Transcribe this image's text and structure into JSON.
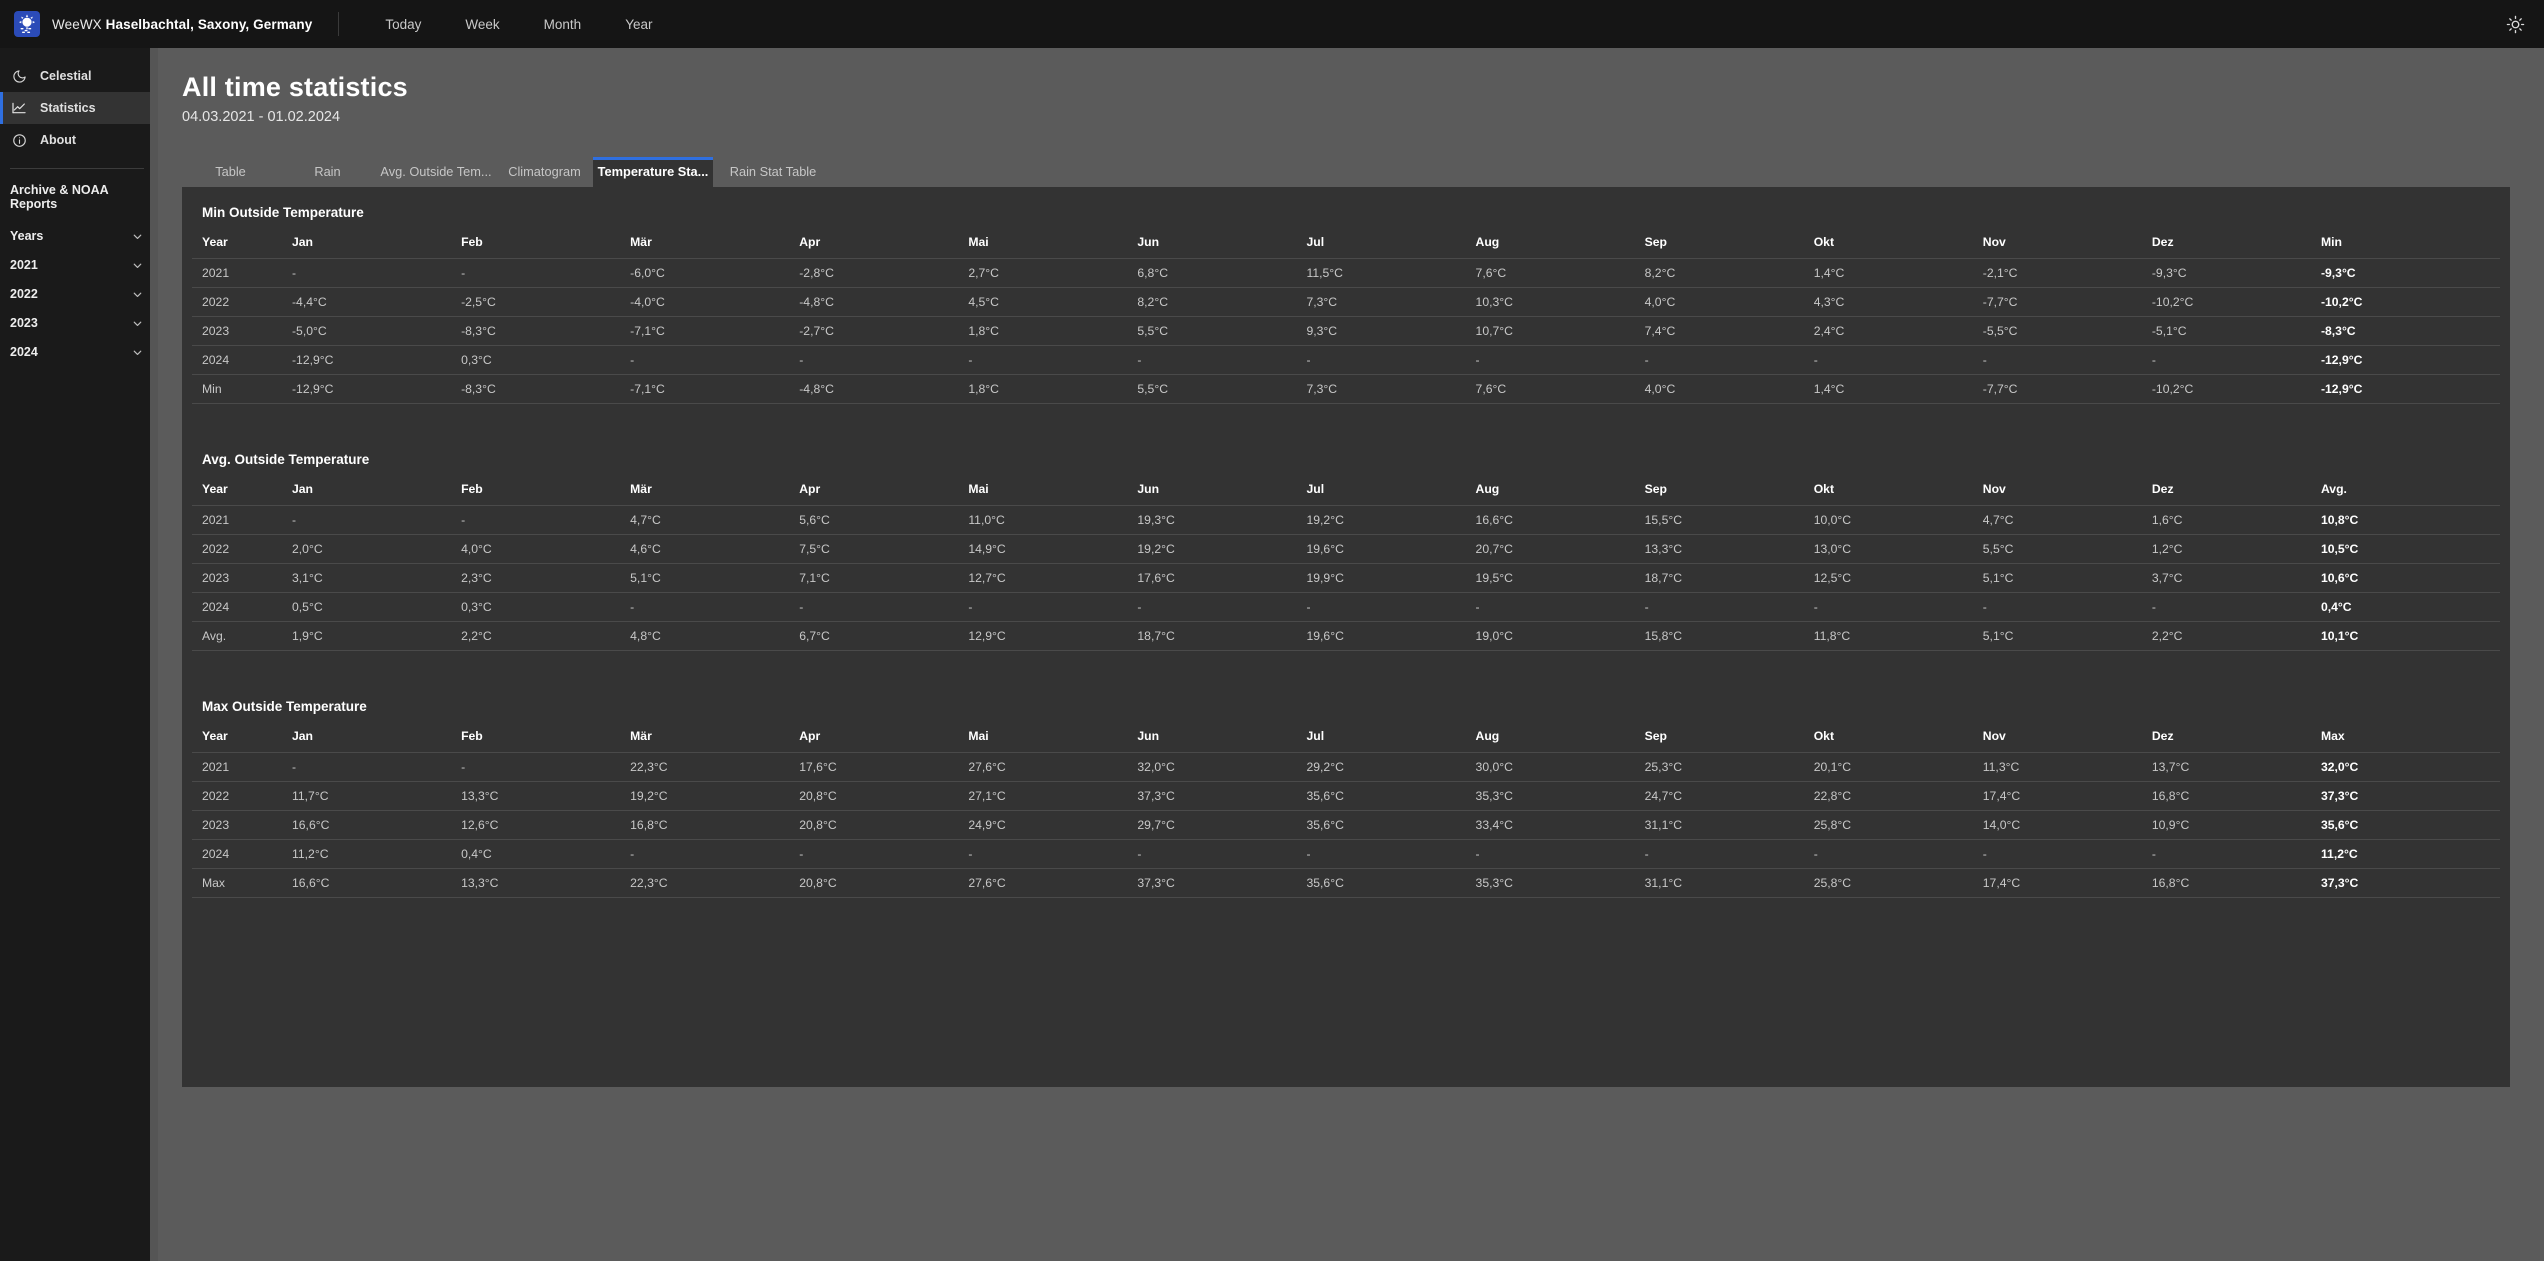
{
  "topbar": {
    "logo_icon": "weewx-sun-logo",
    "app_name": "WeeWX",
    "location": "Haselbachtal, Saxony, Germany",
    "nav": [
      {
        "label": "Today"
      },
      {
        "label": "Week"
      },
      {
        "label": "Month"
      },
      {
        "label": "Year"
      }
    ],
    "theme_toggle_icon": "sun-icon"
  },
  "sidebar": {
    "items": [
      {
        "label": "Celestial",
        "icon": "moon-icon",
        "active": false
      },
      {
        "label": "Statistics",
        "icon": "chart-line-icon",
        "active": true
      },
      {
        "label": "About",
        "icon": "info-circle-icon",
        "active": false
      }
    ],
    "heading": "Archive & NOAA Reports",
    "accordions": [
      {
        "label": "Years",
        "icon": "chevron-down-icon"
      },
      {
        "label": "2021",
        "icon": "chevron-down-icon"
      },
      {
        "label": "2022",
        "icon": "chevron-down-icon"
      },
      {
        "label": "2023",
        "icon": "chevron-down-icon"
      },
      {
        "label": "2024",
        "icon": "chevron-down-icon"
      }
    ]
  },
  "page": {
    "title": "All time statistics",
    "subtitle": "04.03.2021 - 01.02.2024"
  },
  "tabs": [
    {
      "label": "Table",
      "active": false
    },
    {
      "label": "Rain",
      "active": false
    },
    {
      "label": "Avg. Outside Tem...",
      "active": false
    },
    {
      "label": "Climatogram",
      "active": false
    },
    {
      "label": "Temperature Sta...",
      "active": true
    },
    {
      "label": "Rain Stat Table",
      "active": false
    }
  ],
  "tables": [
    {
      "title": "Min Outside Temperature",
      "columns": [
        "Year",
        "Jan",
        "Feb",
        "Mär",
        "Apr",
        "Mai",
        "Jun",
        "Jul",
        "Aug",
        "Sep",
        "Okt",
        "Nov",
        "Dez",
        "Min"
      ],
      "rows": [
        {
          "year": "2021",
          "values": [
            "-",
            "-",
            "-6,0°C",
            "-2,8°C",
            "2,7°C",
            "6,8°C",
            "11,5°C",
            "7,6°C",
            "8,2°C",
            "1,4°C",
            "-2,1°C",
            "-9,3°C"
          ],
          "total": "-9,3°C"
        },
        {
          "year": "2022",
          "values": [
            "-4,4°C",
            "-2,5°C",
            "-4,0°C",
            "-4,8°C",
            "4,5°C",
            "8,2°C",
            "7,3°C",
            "10,3°C",
            "4,0°C",
            "4,3°C",
            "-7,7°C",
            "-10,2°C"
          ],
          "total": "-10,2°C"
        },
        {
          "year": "2023",
          "values": [
            "-5,0°C",
            "-8,3°C",
            "-7,1°C",
            "-2,7°C",
            "1,8°C",
            "5,5°C",
            "9,3°C",
            "10,7°C",
            "7,4°C",
            "2,4°C",
            "-5,5°C",
            "-5,1°C"
          ],
          "total": "-8,3°C"
        },
        {
          "year": "2024",
          "values": [
            "-12,9°C",
            "0,3°C",
            "-",
            "-",
            "-",
            "-",
            "-",
            "-",
            "-",
            "-",
            "-",
            "-"
          ],
          "total": "-12,9°C"
        },
        {
          "year": "Min",
          "values": [
            "-12,9°C",
            "-8,3°C",
            "-7,1°C",
            "-4,8°C",
            "1,8°C",
            "5,5°C",
            "7,3°C",
            "7,6°C",
            "4,0°C",
            "1,4°C",
            "-7,7°C",
            "-10,2°C"
          ],
          "total": "-12,9°C",
          "summary": true
        }
      ]
    },
    {
      "title": "Avg. Outside Temperature",
      "columns": [
        "Year",
        "Jan",
        "Feb",
        "Mär",
        "Apr",
        "Mai",
        "Jun",
        "Jul",
        "Aug",
        "Sep",
        "Okt",
        "Nov",
        "Dez",
        "Avg."
      ],
      "rows": [
        {
          "year": "2021",
          "values": [
            "-",
            "-",
            "4,7°C",
            "5,6°C",
            "11,0°C",
            "19,3°C",
            "19,2°C",
            "16,6°C",
            "15,5°C",
            "10,0°C",
            "4,7°C",
            "1,6°C"
          ],
          "total": "10,8°C"
        },
        {
          "year": "2022",
          "values": [
            "2,0°C",
            "4,0°C",
            "4,6°C",
            "7,5°C",
            "14,9°C",
            "19,2°C",
            "19,6°C",
            "20,7°C",
            "13,3°C",
            "13,0°C",
            "5,5°C",
            "1,2°C"
          ],
          "total": "10,5°C"
        },
        {
          "year": "2023",
          "values": [
            "3,1°C",
            "2,3°C",
            "5,1°C",
            "7,1°C",
            "12,7°C",
            "17,6°C",
            "19,9°C",
            "19,5°C",
            "18,7°C",
            "12,5°C",
            "5,1°C",
            "3,7°C"
          ],
          "total": "10,6°C"
        },
        {
          "year": "2024",
          "values": [
            "0,5°C",
            "0,3°C",
            "-",
            "-",
            "-",
            "-",
            "-",
            "-",
            "-",
            "-",
            "-",
            "-"
          ],
          "total": "0,4°C"
        },
        {
          "year": "Avg.",
          "values": [
            "1,9°C",
            "2,2°C",
            "4,8°C",
            "6,7°C",
            "12,9°C",
            "18,7°C",
            "19,6°C",
            "19,0°C",
            "15,8°C",
            "11,8°C",
            "5,1°C",
            "2,2°C"
          ],
          "total": "10,1°C",
          "summary": true
        }
      ]
    },
    {
      "title": "Max Outside Temperature",
      "columns": [
        "Year",
        "Jan",
        "Feb",
        "Mär",
        "Apr",
        "Mai",
        "Jun",
        "Jul",
        "Aug",
        "Sep",
        "Okt",
        "Nov",
        "Dez",
        "Max"
      ],
      "rows": [
        {
          "year": "2021",
          "values": [
            "-",
            "-",
            "22,3°C",
            "17,6°C",
            "27,6°C",
            "32,0°C",
            "29,2°C",
            "30,0°C",
            "25,3°C",
            "20,1°C",
            "11,3°C",
            "13,7°C"
          ],
          "total": "32,0°C"
        },
        {
          "year": "2022",
          "values": [
            "11,7°C",
            "13,3°C",
            "19,2°C",
            "20,8°C",
            "27,1°C",
            "37,3°C",
            "35,6°C",
            "35,3°C",
            "24,7°C",
            "22,8°C",
            "17,4°C",
            "16,8°C"
          ],
          "total": "37,3°C"
        },
        {
          "year": "2023",
          "values": [
            "16,6°C",
            "12,6°C",
            "16,8°C",
            "20,8°C",
            "24,9°C",
            "29,7°C",
            "35,6°C",
            "33,4°C",
            "31,1°C",
            "25,8°C",
            "14,0°C",
            "10,9°C"
          ],
          "total": "35,6°C"
        },
        {
          "year": "2024",
          "values": [
            "11,2°C",
            "0,4°C",
            "-",
            "-",
            "-",
            "-",
            "-",
            "-",
            "-",
            "-",
            "-",
            "-"
          ],
          "total": "11,2°C"
        },
        {
          "year": "Max",
          "values": [
            "16,6°C",
            "13,3°C",
            "22,3°C",
            "20,8°C",
            "27,6°C",
            "37,3°C",
            "35,6°C",
            "35,3°C",
            "31,1°C",
            "25,8°C",
            "17,4°C",
            "16,8°C"
          ],
          "total": "37,3°C",
          "summary": true
        }
      ]
    }
  ],
  "colors": {
    "accent": "#2f6fe0",
    "topbar_bg": "#151515",
    "sidebar_bg": "#1a1a1a",
    "panel_bg": "#333333",
    "page_bg": "#5b5b5b"
  }
}
